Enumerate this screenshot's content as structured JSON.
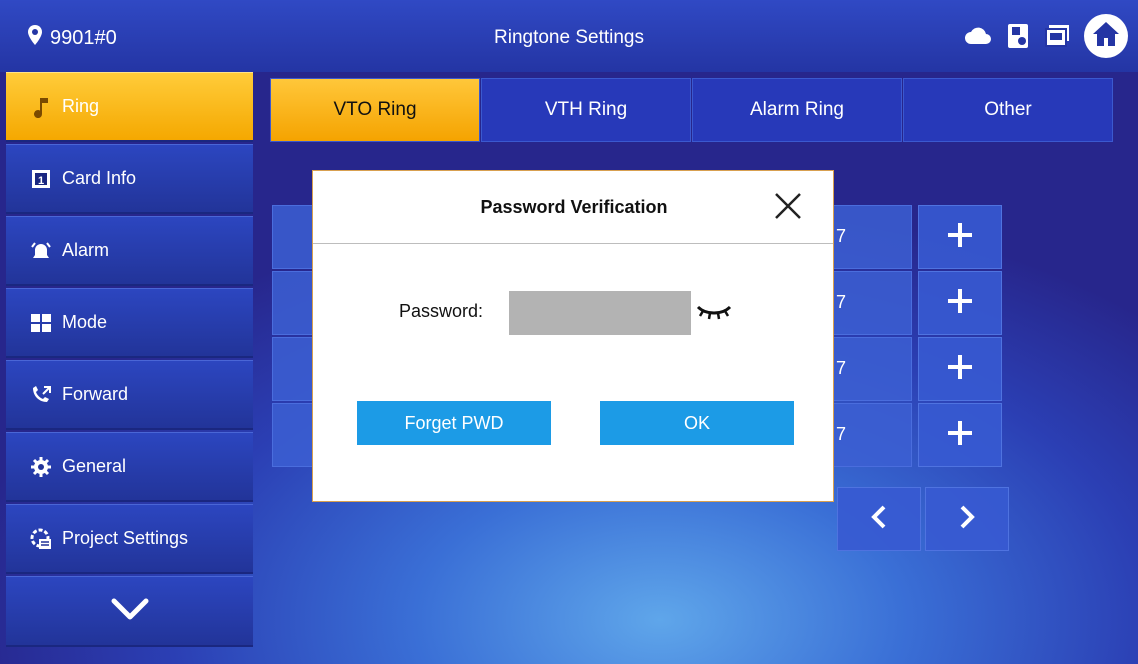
{
  "header": {
    "location": "9901#0",
    "title": "Ringtone Settings",
    "icons": [
      "cloud-icon",
      "sd-card-icon",
      "device-icon",
      "home-icon"
    ]
  },
  "sidebar": {
    "items": [
      {
        "label": "Ring",
        "icon": "music-note-icon",
        "active": true
      },
      {
        "label": "Card Info",
        "icon": "card-icon",
        "active": false
      },
      {
        "label": "Alarm",
        "icon": "alarm-icon",
        "active": false
      },
      {
        "label": "Mode",
        "icon": "mode-grid-icon",
        "active": false
      },
      {
        "label": "Forward",
        "icon": "forward-call-icon",
        "active": false
      },
      {
        "label": "General",
        "icon": "gear-icon",
        "active": false
      },
      {
        "label": "Project Settings",
        "icon": "project-settings-icon",
        "active": false
      }
    ],
    "more_icon": "chevron-down-icon"
  },
  "tabs": [
    {
      "label": "VTO Ring",
      "active": true
    },
    {
      "label": "VTH Ring",
      "active": false
    },
    {
      "label": "Alarm Ring",
      "active": false
    },
    {
      "label": "Other",
      "active": false
    }
  ],
  "rows": [
    {
      "value_fragment": "7"
    },
    {
      "value_fragment": "7"
    },
    {
      "value_fragment": "7"
    },
    {
      "value_fragment": "7"
    }
  ],
  "dialog": {
    "title": "Password Verification",
    "password_label": "Password:",
    "password_value": "",
    "forget_label": "Forget PWD",
    "ok_label": "OK"
  },
  "colors": {
    "accent": "#f5a800",
    "button": "#1c9be6",
    "topbar": "#2435a4"
  }
}
